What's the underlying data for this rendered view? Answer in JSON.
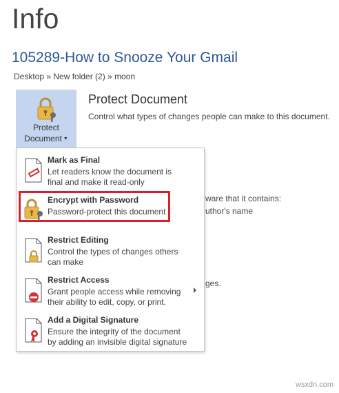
{
  "page": {
    "title": "Info",
    "document_title": "105289-How to Snooze Your Gmail",
    "breadcrumb": "Desktop » New folder (2) » moon"
  },
  "protect": {
    "button_label_line1": "Protect",
    "button_label_line2": "Document",
    "heading": "Protect Document",
    "description": "Control what types of changes people can make to this document."
  },
  "background_text": {
    "line1": "ware that it contains:",
    "line2": "uthor's name",
    "line3": "ges."
  },
  "menu": {
    "items": [
      {
        "title": "Mark as Final",
        "desc_line1": "Let readers know the document is",
        "desc_line2": "final and make it read-only"
      },
      {
        "title": "Encrypt with Password",
        "desc_line1": "Password-protect this document",
        "desc_line2": ""
      },
      {
        "title": "Restrict Editing",
        "desc_line1": "Control the types of changes others",
        "desc_line2": "can make"
      },
      {
        "title": "Restrict Access",
        "desc_line1": "Grant people access while removing",
        "desc_line2": "their ability to edit, copy, or print."
      },
      {
        "title": "Add a Digital Signature",
        "desc_line1": "Ensure the integrity of the document",
        "desc_line2": "by adding an invisible digital signature"
      }
    ]
  },
  "watermark": "wsxdn.com",
  "colors": {
    "accent_blue": "#2b579a",
    "button_selected": "#c5d5ef",
    "highlight_red": "#d9212c",
    "lock_gold": "#e8b647"
  }
}
